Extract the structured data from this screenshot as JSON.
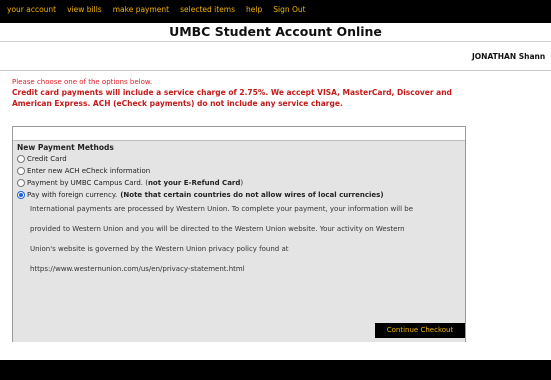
{
  "nav": {
    "items": [
      "your account",
      "view bills",
      "make payment",
      "selected items",
      "help",
      "Sign Out"
    ]
  },
  "header": {
    "title": "UMBC Student Account Online"
  },
  "user": {
    "name": "JONATHAN Shann"
  },
  "messages": {
    "choose": "Please choose one of the options below.",
    "charge": "Credit card payments will include a service charge of 2.75%. We accept VISA, MasterCard, Discover and American Express. ACH (eCheck payments) do not include any service charge."
  },
  "payment": {
    "heading": "New Payment Methods",
    "options": [
      {
        "label": "Credit Card",
        "selected": false
      },
      {
        "label": "Enter new ACH eCheck information",
        "selected": false
      },
      {
        "label": "Payment by UMBC Campus Card. (",
        "bold": "not your E-Refund Card",
        "after": ")",
        "selected": false
      },
      {
        "label": "Pay with foreign currency.",
        "bold": "(Note that certain countries do not allow wires of local currencies)",
        "selected": true
      }
    ],
    "description": [
      "International payments are processed by Western Union. To complete your payment, your information will be",
      "provided to Western Union and you will be directed to the Western Union website. Your activity on Western",
      "Union's website is governed by the Western Union privacy policy found at",
      "https://www.westernunion.com/us/en/privacy-statement.html"
    ],
    "continue_label": "Continue Checkout"
  },
  "colors": {
    "nav_bg": "#000000",
    "nav_link": "#f0b400",
    "alert": "#e0202a",
    "radio_selected": "#1a64d8"
  }
}
